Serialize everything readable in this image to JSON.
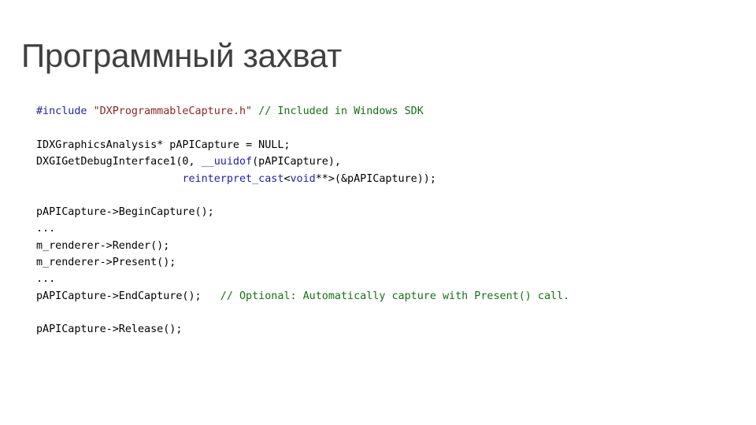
{
  "slide": {
    "title": "Программный захват",
    "background_color": "#ffffff",
    "title_color": "#404040"
  },
  "colors": {
    "keyword": "#2222AA",
    "string": "#8B2424",
    "comment": "#157015",
    "plain": "#000000"
  },
  "code": {
    "language": "cpp",
    "lines": [
      {
        "id": "line-include",
        "tokens": [
          {
            "text": "#include ",
            "type": "keyword"
          },
          {
            "text": "\"DXProgrammableCapture.h\"",
            "type": "string"
          },
          {
            "text": " ",
            "type": "plain"
          },
          {
            "text": "// Included in Windows SDK",
            "type": "comment"
          }
        ]
      },
      {
        "id": "line-blank-1",
        "tokens": []
      },
      {
        "id": "line-declare-capture",
        "tokens": [
          {
            "text": "IDXGraphicsAnalysis* pAPICapture = NULL;",
            "type": "plain"
          }
        ]
      },
      {
        "id": "line-get-debug-interface",
        "tokens": [
          {
            "text": "DXGIGetDebugInterface1(0, ",
            "type": "plain"
          },
          {
            "text": "__uuidof",
            "type": "keyword"
          },
          {
            "text": "(pAPICapture),",
            "type": "plain"
          }
        ]
      },
      {
        "id": "line-reinterpret-cast",
        "tokens": [
          {
            "text": "                       ",
            "type": "plain"
          },
          {
            "text": "reinterpret_cast",
            "type": "keyword"
          },
          {
            "text": "<",
            "type": "plain"
          },
          {
            "text": "void",
            "type": "keyword"
          },
          {
            "text": "**>(&pAPICapture));",
            "type": "plain"
          }
        ]
      },
      {
        "id": "line-blank-2",
        "tokens": []
      },
      {
        "id": "line-begin-capture",
        "tokens": [
          {
            "text": "pAPICapture->BeginCapture();",
            "type": "plain"
          }
        ]
      },
      {
        "id": "line-ellipsis-1",
        "tokens": [
          {
            "text": "...",
            "type": "plain"
          }
        ]
      },
      {
        "id": "line-render",
        "tokens": [
          {
            "text": "m_renderer->Render();",
            "type": "plain"
          }
        ]
      },
      {
        "id": "line-present",
        "tokens": [
          {
            "text": "m_renderer->Present();",
            "type": "plain"
          }
        ]
      },
      {
        "id": "line-ellipsis-2",
        "tokens": [
          {
            "text": "...",
            "type": "plain"
          }
        ]
      },
      {
        "id": "line-end-capture",
        "tokens": [
          {
            "text": "pAPICapture->EndCapture();   ",
            "type": "plain"
          },
          {
            "text": "// Optional: Automatically capture with Present() call.",
            "type": "comment"
          }
        ]
      },
      {
        "id": "line-blank-3",
        "tokens": []
      },
      {
        "id": "line-release",
        "tokens": [
          {
            "text": "pAPICapture->Release();",
            "type": "plain"
          }
        ]
      }
    ]
  }
}
